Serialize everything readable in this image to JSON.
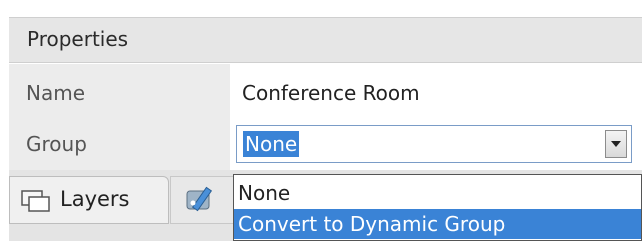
{
  "properties": {
    "title": "Properties",
    "rows": [
      {
        "label": "Name",
        "value": "Conference Room"
      },
      {
        "label": "Group",
        "value": "None"
      }
    ]
  },
  "tabs": {
    "layers_label": "Layers",
    "other_icon": "pencil-palette-icon"
  },
  "dropdown": {
    "options": [
      "None",
      "Convert to Dynamic Group"
    ],
    "highlighted_index": 1
  },
  "colors": {
    "selection": "#3a83d6",
    "label_bg": "#ececec",
    "header_bg": "#e6e6e6"
  }
}
